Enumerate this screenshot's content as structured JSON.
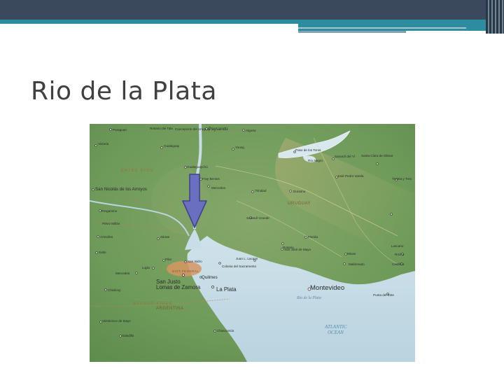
{
  "slide": {
    "title": "Rio de la Plata"
  },
  "map": {
    "places": [
      {
        "key": "paraguari",
        "text": "Paraguari"
      },
      {
        "key": "rosario_tala",
        "text": "Rosario del Tala"
      },
      {
        "key": "concepcion",
        "text": "Concepción del Uruguay"
      },
      {
        "key": "paysandu",
        "text": "Paysandú"
      },
      {
        "key": "algorta",
        "text": "Algorta"
      },
      {
        "key": "victoria",
        "text": "Victoria"
      },
      {
        "key": "gualeguay",
        "text": "Gualeguay"
      },
      {
        "key": "young",
        "text": "Young"
      },
      {
        "key": "paso_toros",
        "text": "Paso de los Toros"
      },
      {
        "key": "rio_negro",
        "text": "Río Negro"
      },
      {
        "key": "sarandi_yi",
        "text": "Sarandí del Yí"
      },
      {
        "key": "santa_clara",
        "text": "Santa Clara de Olimar"
      },
      {
        "key": "gualeguaychu",
        "text": "Gualeguaychú"
      },
      {
        "key": "fray_bentos",
        "text": "Fray Bentos"
      },
      {
        "key": "mercedes",
        "text": "Mercedes"
      },
      {
        "key": "durazno",
        "text": "Durazno"
      },
      {
        "key": "jose_pedro_varela",
        "text": "José Pedro Varela"
      },
      {
        "key": "corte",
        "text": "Sarandí Grande"
      },
      {
        "key": "trinidad",
        "text": "Trinidad"
      },
      {
        "key": "treinta_tres",
        "text": "Treinta y Tres"
      },
      {
        "key": "san_nicolas",
        "text": "San Nicolás de los Arroyos"
      },
      {
        "key": "pergamino",
        "text": "Pergamino"
      },
      {
        "key": "pena_millas",
        "text": "Pérez Millán"
      },
      {
        "key": "rosario_uy",
        "text": "Rosario"
      },
      {
        "key": "lascano",
        "text": "Lascano"
      },
      {
        "key": "florida",
        "text": "Florida"
      },
      {
        "key": "arrecifes",
        "text": "Arrecifes"
      },
      {
        "key": "zarate",
        "text": "Zárate"
      },
      {
        "key": "minas",
        "text": "Minas"
      },
      {
        "key": "salto",
        "text": "Salto"
      },
      {
        "key": "san_jose",
        "text": "San José de Mayo"
      },
      {
        "key": "castillos",
        "text": "Castillos"
      },
      {
        "key": "pilar",
        "text": "Pilar"
      },
      {
        "key": "san_isidro",
        "text": "San Isidro"
      },
      {
        "key": "juan_lacaze",
        "text": "Juan L. Lacaze"
      },
      {
        "key": "maldonado",
        "text": "Maldonado"
      },
      {
        "key": "rocha",
        "text": "Rocha"
      },
      {
        "key": "lujan",
        "text": "Luján"
      },
      {
        "key": "colonia",
        "text": "Colonia del Sacramento"
      },
      {
        "key": "mercedes_ar",
        "text": "Mercedes"
      },
      {
        "key": "san_justo",
        "text": "San Justo"
      },
      {
        "key": "lomas",
        "text": "Lomas de Zamora"
      },
      {
        "key": "quilmes",
        "text": "Quilmes"
      },
      {
        "key": "la_plata",
        "text": "La Plata"
      },
      {
        "key": "montevideo",
        "text": "Montevideo"
      },
      {
        "key": "chivilcoy",
        "text": "Chivilcoy"
      },
      {
        "key": "punta_este",
        "text": "Punta del Este"
      },
      {
        "key": "veinticinco",
        "text": "Veinticinco de Mayo"
      },
      {
        "key": "chascomus",
        "text": "Chascomús"
      },
      {
        "key": "saladillo",
        "text": "Saladillo"
      }
    ],
    "regions": {
      "entre_rios": "ENTRE RÍOS",
      "uruguay": "URUGUAY",
      "buenos_aires": "BUENOS AIRES",
      "argentina": "ARGENTINA",
      "capital": "DIST.FEDERAL",
      "capital2": "BUENOS AIRES"
    },
    "water": {
      "rio_plata": "Río de la Plata",
      "atlantic": "ATLANTIC",
      "ocean": "OCEAN"
    },
    "arrow_target": "Río de la Plata",
    "colors": {
      "land": "#6f9a5a",
      "water": "#c8dde8",
      "arrow": "#6a6fc0"
    }
  }
}
